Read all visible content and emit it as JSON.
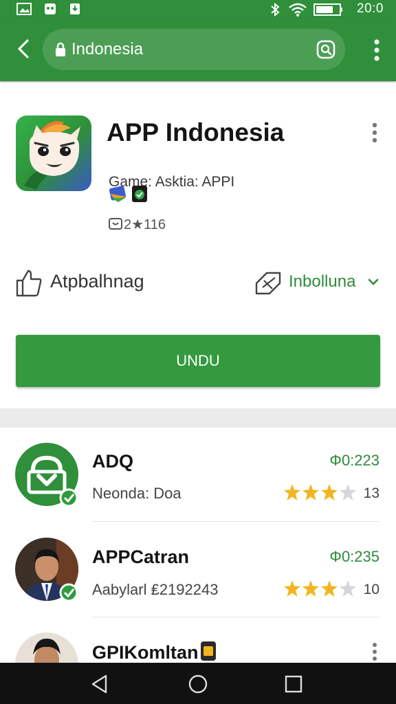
{
  "status_bar": {
    "time": "20:0"
  },
  "url_bar": {
    "url_text": "Indonesia"
  },
  "app": {
    "title": "APP Indonesia",
    "developer_line": "Game: Asktia: APPI",
    "rating_text": "2★116",
    "wishlist_label": "Atpbalhnag",
    "language_label": "Inbolluna",
    "install_label": "UNDU"
  },
  "list": [
    {
      "title": "ADQ",
      "subtitle": "Neonda: Doa",
      "price": "Φ0:223",
      "rating": 3,
      "count": "13"
    },
    {
      "title": "APPCatran",
      "subtitle": "Aabylarl ₤2192243",
      "price": "Φ0:235",
      "rating": 3,
      "count": "10"
    },
    {
      "title": "GPIKomltan",
      "subtitle": "",
      "price": "",
      "rating": 0,
      "count": ""
    }
  ],
  "colors": {
    "primary_green": "#2f8f3a",
    "button_green": "#35993f",
    "star_gold": "#f2b51f"
  },
  "icons": [
    "back-arrow-icon",
    "lock-icon",
    "search-icon",
    "more-vert-icon",
    "thumbs-up-icon",
    "language-icon",
    "chevron-down-icon",
    "verified-badge-icon",
    "star-icon",
    "nav-back-icon",
    "nav-home-icon",
    "nav-recents-icon"
  ]
}
